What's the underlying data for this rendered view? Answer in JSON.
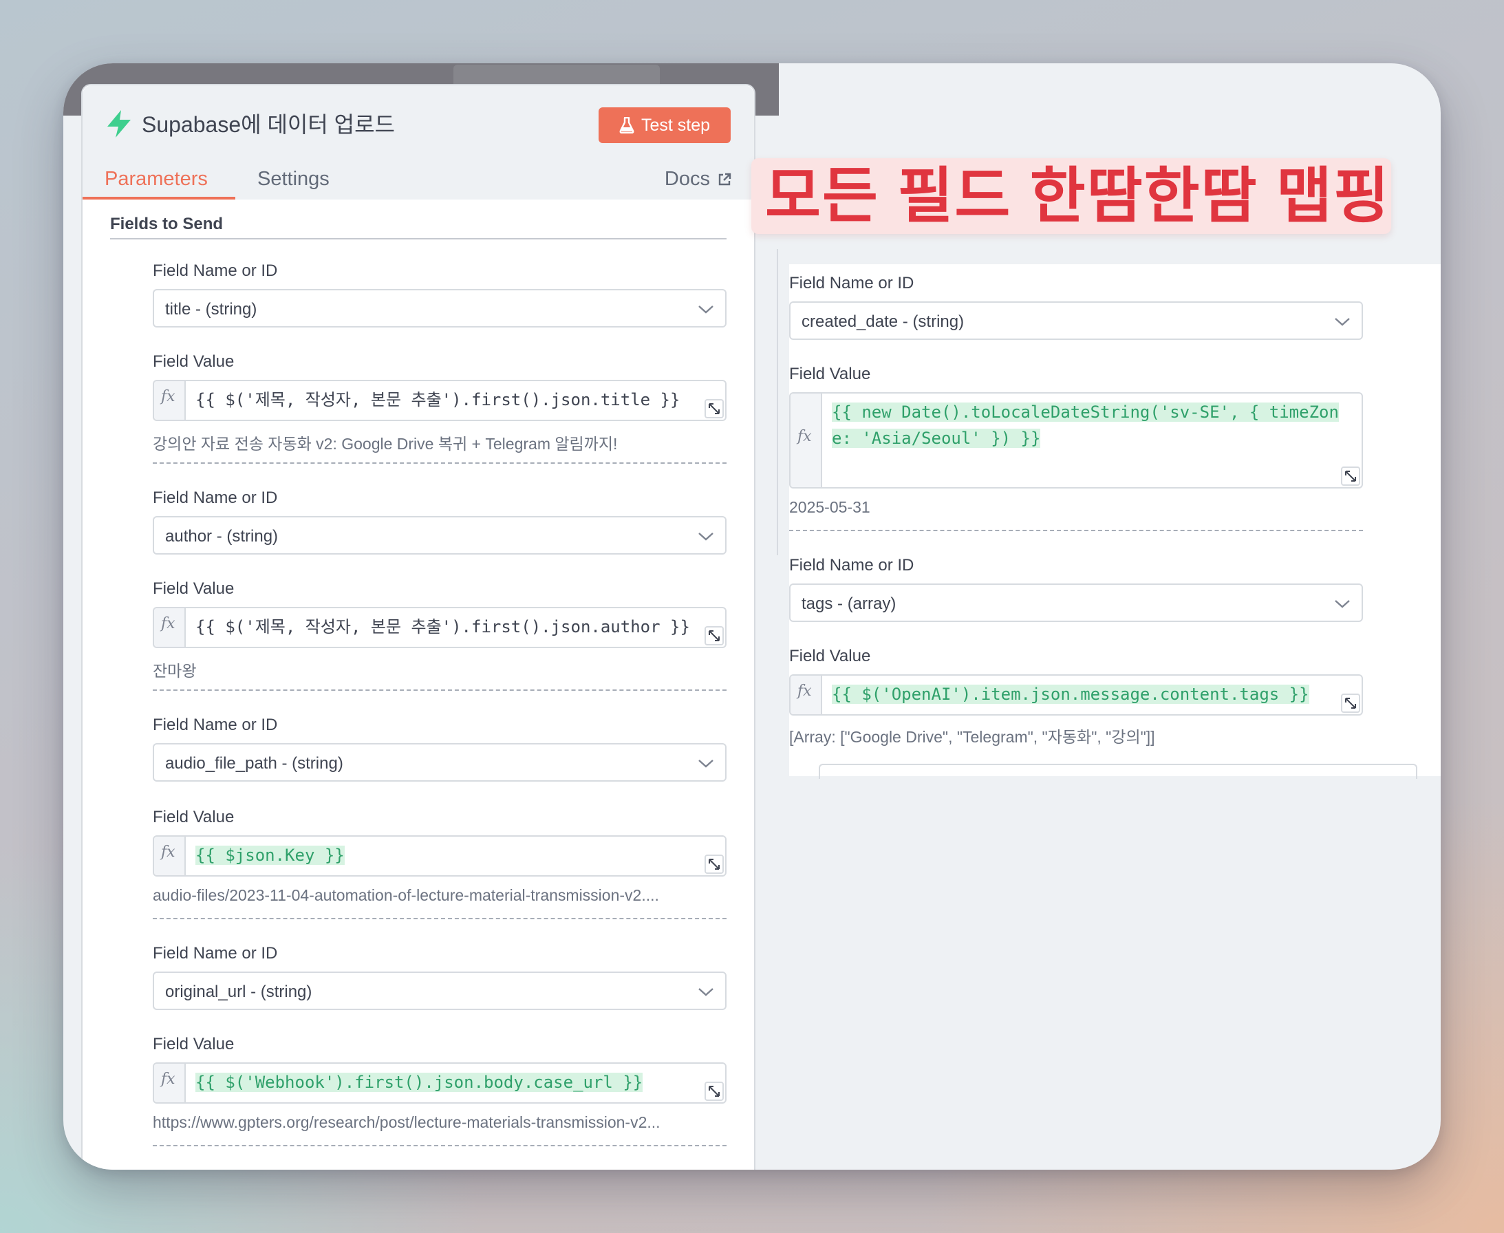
{
  "node": {
    "title": "Supabase에 데이터 업로드",
    "test_step": "Test step",
    "tabs": {
      "parameters": "Parameters",
      "settings": "Settings"
    },
    "docs": "Docs",
    "section_title": "Fields to Send"
  },
  "labels": {
    "field_name": "Field Name or ID",
    "field_value": "Field Value",
    "fx": "fx"
  },
  "left_fields": [
    {
      "name": "title - (string)",
      "value": "{{ $('제목, 작성자, 본문 추출').first().json.title }}",
      "preview": "강의안 자료 전송 자동화 v2: Google Drive 복귀 + Telegram 알림까지!"
    },
    {
      "name": "author - (string)",
      "value": "{{ $('제목, 작성자, 본문 추출').first().json.author }}",
      "preview": "잔마왕"
    },
    {
      "name": "audio_file_path - (string)",
      "value": "{{ $json.Key }}",
      "preview": "audio-files/2023-11-04-automation-of-lecture-material-transmission-v2...."
    },
    {
      "name": "original_url - (string)",
      "value": "{{ $('Webhook').first().json.body.case_url }}",
      "preview": "https://www.gpters.org/research/post/lecture-materials-transmission-v2..."
    }
  ],
  "right_fields": [
    {
      "name": "created_date - (string)",
      "value": "{{ new Date().toLocaleDateString('sv-SE', { timeZone: 'Asia/Seoul' }) }}",
      "preview": "2025-05-31"
    },
    {
      "name": "tags - (array)",
      "value": "{{ $('OpenAI').item.json.message.content.tags }}",
      "preview": "[Array: [\"Google Drive\", \"Telegram\", \"자동화\", \"강의\"]]"
    }
  ],
  "banner": "모든 필드 한땀한땀 맵핑",
  "colors": {
    "accent": "#ee7158",
    "expr_green": "#2fa06a",
    "expr_green_bg": "#d7f3e2",
    "banner_red": "#e0353f",
    "supabase_green": "#3ecf8e"
  },
  "icons": {
    "node": "supabase-bolt-icon",
    "test": "flask-icon",
    "docs": "external-link-icon",
    "select": "chevron-down-icon",
    "expand": "expand-icon"
  }
}
